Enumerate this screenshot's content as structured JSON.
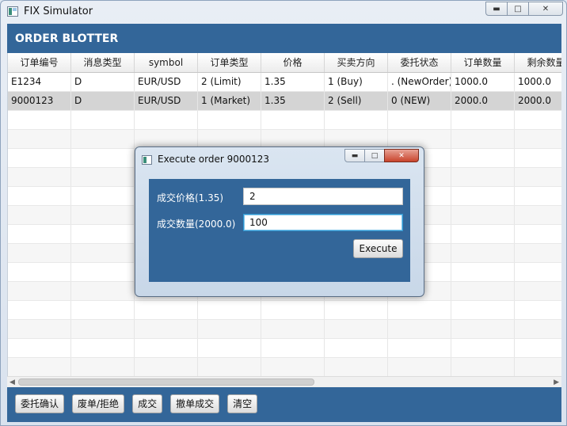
{
  "window": {
    "title": "FIX Simulator"
  },
  "blotter": {
    "title": "ORDER BLOTTER"
  },
  "table": {
    "columns": [
      "订单编号",
      "消息类型",
      "symbol",
      "订单类型",
      "价格",
      "买卖方向",
      "委托状态",
      "订单数量",
      "剩余数量"
    ],
    "rows": [
      [
        "E1234",
        "D",
        "EUR/USD",
        "2 (Limit)",
        "1.35",
        "1 (Buy)",
        ". (NewOrder)",
        "1000.0",
        "1000.0"
      ],
      [
        "9000123",
        "D",
        "EUR/USD",
        "1 (Market)",
        "1.35",
        "2 (Sell)",
        "0 (NEW)",
        "2000.0",
        "2000.0"
      ]
    ]
  },
  "footer": {
    "buttons": [
      "委托确认",
      "废单/拒绝",
      "成交",
      "撤单成交",
      "清空"
    ]
  },
  "dialog": {
    "title": "Execute order 9000123",
    "price_label": "成交价格(1.35)",
    "price_value": "2",
    "qty_label": "成交数量(2000.0)",
    "qty_value": "100",
    "execute_label": "Execute"
  },
  "colors": {
    "accent": "#336699",
    "selected_row": "#d4d4d4"
  },
  "icons": {
    "minimize": "minimize-icon",
    "maximize": "maximize-icon",
    "close": "close-icon"
  }
}
